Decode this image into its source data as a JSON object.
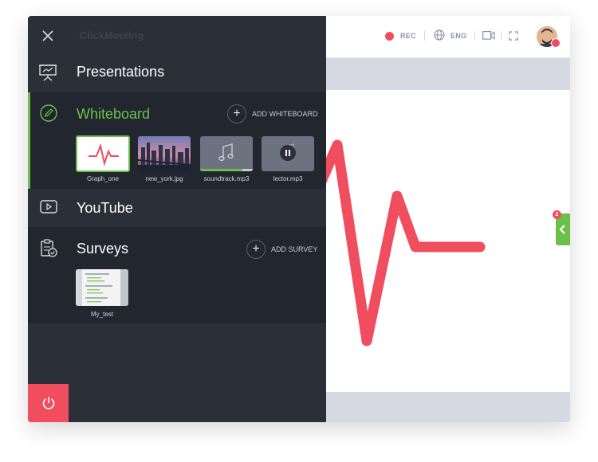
{
  "topbar": {
    "logo": "ClickMeeting",
    "rec_label": "REC",
    "lang_label": "ENG"
  },
  "sidebar": {
    "presentations": {
      "title": "Presentations"
    },
    "whiteboard": {
      "title": "Whiteboard",
      "add_label": "ADD WHITEBOARD",
      "files": [
        {
          "name": "Graph_one"
        },
        {
          "name": "new_york.jpg"
        },
        {
          "name": "soundtrack.mp3",
          "progress": 0.8
        },
        {
          "name": "lector.mp3"
        }
      ]
    },
    "youtube": {
      "title": "YouTube"
    },
    "surveys": {
      "title": "Surveys",
      "add_label": "ADD SURVEY",
      "files": [
        {
          "name": "My_test"
        }
      ]
    }
  },
  "side_tab": {
    "badge": "2"
  },
  "colors": {
    "accent_green": "#6cc04a",
    "alert_red": "#f04e5e",
    "panel": "#2b2f38",
    "chart_line": "#f04e5e"
  }
}
